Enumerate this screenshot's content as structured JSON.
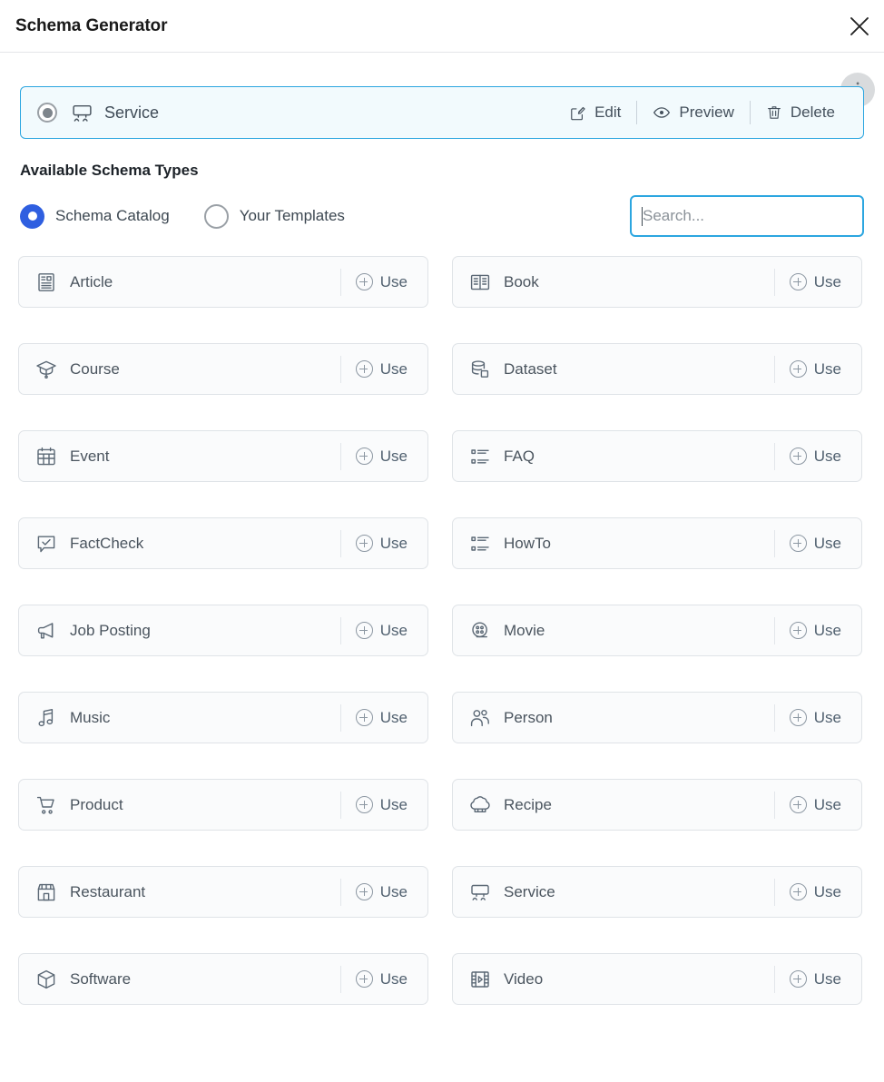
{
  "header": {
    "title": "Schema Generator",
    "close_label": "Close"
  },
  "selected_schema": {
    "name": "Service",
    "icon": "service-icon",
    "selected": true,
    "info_badge": "i",
    "actions": [
      {
        "label": "Edit",
        "icon": "edit-icon"
      },
      {
        "label": "Preview",
        "icon": "eye-icon"
      },
      {
        "label": "Delete",
        "icon": "trash-icon"
      }
    ]
  },
  "available": {
    "section_title": "Available Schema Types",
    "source_options": [
      {
        "label": "Schema Catalog",
        "checked": true
      },
      {
        "label": "Your Templates",
        "checked": false
      }
    ],
    "search": {
      "value": "",
      "placeholder": "Search..."
    },
    "use_label": "Use",
    "schemas": [
      {
        "name": "Article",
        "icon": "article-icon",
        "use": "Use"
      },
      {
        "name": "Book",
        "icon": "book-icon",
        "use": "Use"
      },
      {
        "name": "Course",
        "icon": "graduation-cap-icon",
        "use": "Use"
      },
      {
        "name": "Dataset",
        "icon": "database-icon",
        "use": "Use"
      },
      {
        "name": "Event",
        "icon": "calendar-icon",
        "use": "Use"
      },
      {
        "name": "FAQ",
        "icon": "list-icon",
        "use": "Use"
      },
      {
        "name": "FactCheck",
        "icon": "check-square-icon",
        "use": "Use"
      },
      {
        "name": "HowTo",
        "icon": "list-icon",
        "use": "Use"
      },
      {
        "name": "Job Posting",
        "icon": "megaphone-icon",
        "use": "Use"
      },
      {
        "name": "Movie",
        "icon": "film-reel-icon",
        "use": "Use"
      },
      {
        "name": "Music",
        "icon": "music-note-icon",
        "use": "Use"
      },
      {
        "name": "Person",
        "icon": "people-icon",
        "use": "Use"
      },
      {
        "name": "Product",
        "icon": "cart-icon",
        "use": "Use"
      },
      {
        "name": "Recipe",
        "icon": "chef-hat-icon",
        "use": "Use"
      },
      {
        "name": "Restaurant",
        "icon": "storefront-icon",
        "use": "Use"
      },
      {
        "name": "Service",
        "icon": "service-icon",
        "use": "Use"
      },
      {
        "name": "Software",
        "icon": "cube-icon",
        "use": "Use"
      },
      {
        "name": "Video",
        "icon": "video-icon",
        "use": "Use"
      }
    ]
  },
  "colors": {
    "accent_blue": "#2ca6e0",
    "radio_blue": "#2f5fe0",
    "card_bg": "#fafbfc",
    "selected_bg": "#f2fafd"
  }
}
